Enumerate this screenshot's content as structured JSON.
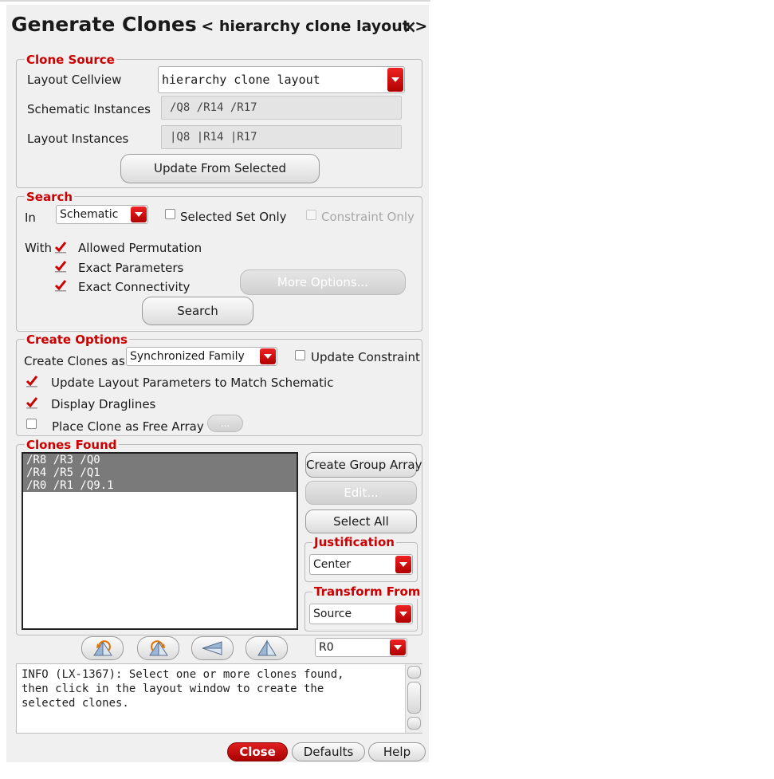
{
  "window": {
    "title": "Generate Clones",
    "subtitle": "< hierarchy  clone  layout  >",
    "close_glyph": "×"
  },
  "clone_source": {
    "legend": "Clone Source",
    "layout_cellview_label": "Layout Cellview",
    "layout_cellview_value": "hierarchy clone layout",
    "schematic_instances_label": "Schematic Instances",
    "schematic_instances_value": "/Q8 /R14 /R17",
    "layout_instances_label": "Layout Instances",
    "layout_instances_value": "|Q8 |R14 |R17",
    "update_button": "Update From Selected"
  },
  "search": {
    "legend": "Search",
    "in_label": "In",
    "in_value": "Schematic",
    "selected_set_only": "Selected Set Only",
    "constraint_only": "Constraint Only",
    "with_label": "With",
    "allowed_permutation": "Allowed Permutation",
    "exact_parameters": "Exact Parameters",
    "exact_connectivity": "Exact Connectivity",
    "more_options_button": "More Options...",
    "search_button": "Search"
  },
  "create_options": {
    "legend": "Create Options",
    "create_clones_as_label": "Create Clones as",
    "create_clones_as_value": "Synchronized Family",
    "update_constraint": "Update Constraint",
    "update_layout_params": "Update Layout Parameters to Match Schematic",
    "display_draglines": "Display Draglines",
    "place_free_array": "Place Clone as Free Array",
    "ellipsis_button": "..."
  },
  "clones_found": {
    "legend": "Clones Found",
    "items": [
      "/R8 /R3 /Q0",
      "/R4 /R5 /Q1",
      "/R0 /R1 /Q9.1"
    ],
    "create_group_array_button": "Create Group Array",
    "edit_button": "Edit...",
    "select_all_button": "Select All",
    "justification_legend": "Justification",
    "justification_value": "Center",
    "transform_from_legend": "Transform From",
    "transform_from_value": "Source"
  },
  "orientation": {
    "rotation_value": "R0"
  },
  "message": {
    "text": "INFO (LX-1367): Select one or more clones found,\nthen click in the layout window to create the\nselected clones."
  },
  "footer": {
    "close_button": "Close",
    "defaults_button": "Defaults",
    "help_button": "Help"
  },
  "colors": {
    "accent_red": "#cc0000",
    "panel_bg": "#f0f0f0",
    "selection_gray": "#7a7a7a"
  }
}
